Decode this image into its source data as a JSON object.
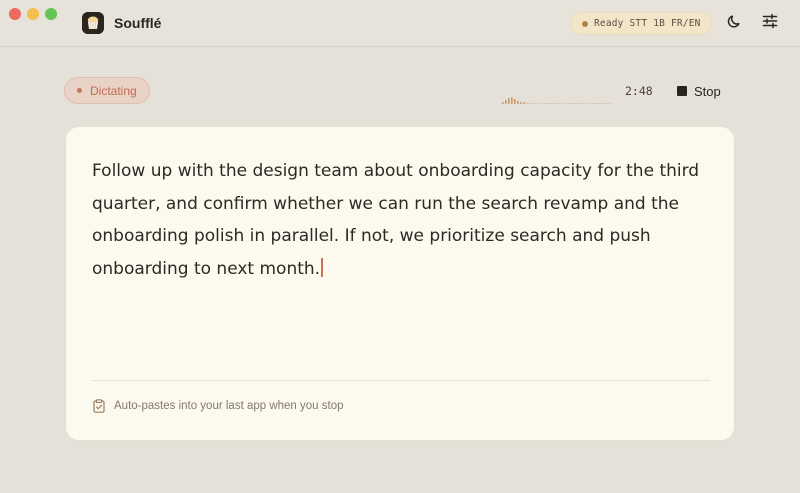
{
  "app": {
    "name": "Soufflé"
  },
  "status": {
    "text": "Ready  STT 1B FR/EN"
  },
  "recording": {
    "state_label": "Dictating",
    "timer": "2:48",
    "stop_label": "Stop"
  },
  "transcript": {
    "text": "Follow up with the design team about onboarding capacity for the third quarter, and confirm whether we can run the search revamp and the onboarding polish in parallel. If not, we prioritize search and push onboarding to next month."
  },
  "footer": {
    "hint": "Auto-pastes into your last app when you stop"
  },
  "icons": {
    "app": "souffle-icon",
    "theme": "moon-icon",
    "settings": "sliders-icon",
    "hint": "clipboard-icon"
  },
  "colors": {
    "accent": "#c9735a",
    "status_dot": "#b3843f",
    "card_bg": "#fcf9ee",
    "window_bg": "#e5e1d8"
  }
}
